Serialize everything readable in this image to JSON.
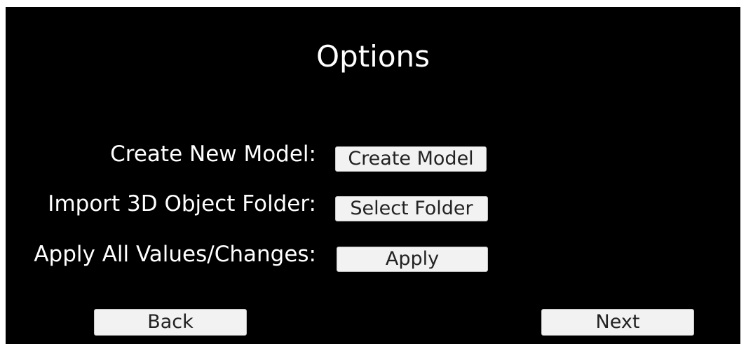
{
  "title": "Options",
  "rows": [
    {
      "label": "Create New Model:",
      "button": "Create Model"
    },
    {
      "label": "Import 3D Object Folder:",
      "button": "Select Folder"
    },
    {
      "label": "Apply All Values/Changes:",
      "button": "Apply"
    }
  ],
  "nav": {
    "back": "Back",
    "next": "Next"
  }
}
